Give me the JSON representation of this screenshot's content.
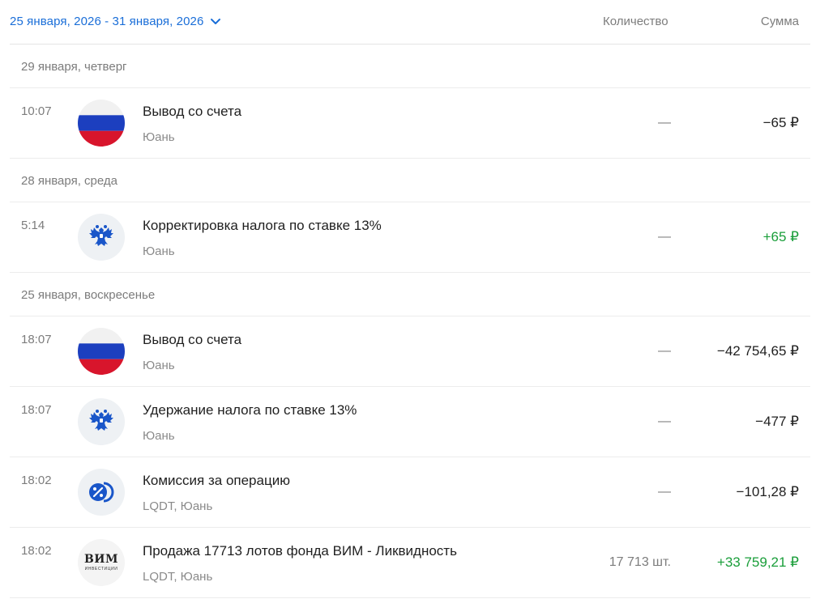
{
  "header": {
    "date_range": "25 января, 2026 - 31 января, 2026",
    "qty_col": "Количество",
    "sum_col": "Сумма"
  },
  "colors": {
    "accent": "#1a6ed8",
    "positive": "#1a9e3a",
    "muted": "#7c7c7c"
  },
  "groups": [
    {
      "day": "29 января, четверг",
      "ops": [
        {
          "time": "10:07",
          "icon": "russia-flag-icon",
          "title": "Вывод со счета",
          "sub": "Юань",
          "qty": "—",
          "sum": "−65 ₽",
          "positive": false
        }
      ]
    },
    {
      "day": "28 января, среда",
      "ops": [
        {
          "time": "5:14",
          "icon": "tax-eagle-icon",
          "title": "Корректировка налога по ставке 13%",
          "sub": "Юань",
          "qty": "—",
          "sum": "+65 ₽",
          "positive": true
        }
      ]
    },
    {
      "day": "25 января, воскресенье",
      "ops": [
        {
          "time": "18:07",
          "icon": "russia-flag-icon",
          "title": "Вывод со счета",
          "sub": "Юань",
          "qty": "—",
          "sum": "−42 754,65 ₽",
          "positive": false
        },
        {
          "time": "18:07",
          "icon": "tax-eagle-icon",
          "title": "Удержание налога по ставке 13%",
          "sub": "Юань",
          "qty": "—",
          "sum": "−477 ₽",
          "positive": false
        },
        {
          "time": "18:02",
          "icon": "commission-percent-icon",
          "title": "Комиссия за операцию",
          "sub": "LQDT, Юань",
          "qty": "—",
          "sum": "−101,28 ₽",
          "positive": false
        },
        {
          "time": "18:02",
          "icon": "vim-logo",
          "title": "Продажа 17713 лотов фонда ВИМ - Ликвидность",
          "sub": "LQDT, Юань",
          "qty": "17 713 шт.",
          "sum": "+33 759,21 ₽",
          "positive": true,
          "logo_main": "ВИМ",
          "logo_small": "ИНВЕСТИЦИИ"
        }
      ]
    }
  ]
}
